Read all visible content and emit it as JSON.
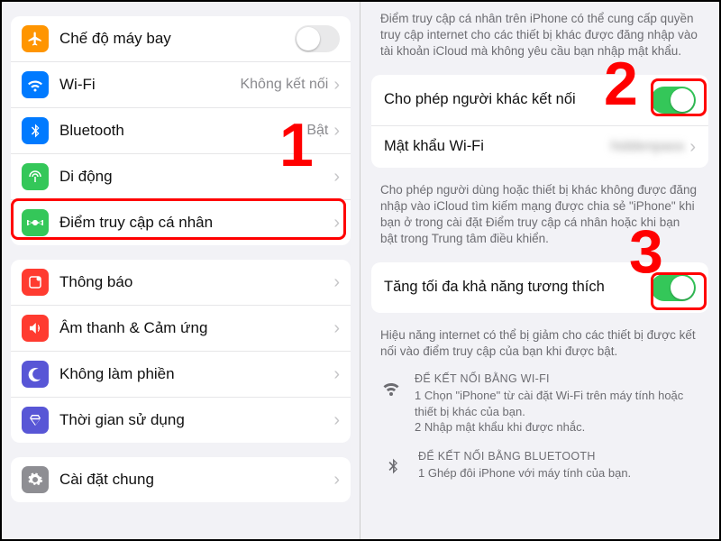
{
  "left": {
    "airplane": "Chế độ máy bay",
    "wifi": "Wi-Fi",
    "wifi_value": "Không kết nối",
    "bluetooth": "Bluetooth",
    "bluetooth_value": "Bật",
    "cellular": "Di động",
    "hotspot": "Điểm truy cập cá nhân",
    "notifications": "Thông báo",
    "sound": "Âm thanh & Cảm ứng",
    "dnd": "Không làm phiền",
    "screentime": "Thời gian sử dụng",
    "general": "Cài đặt chung"
  },
  "right": {
    "intro": "Điểm truy cập cá nhân trên iPhone có thể cung cấp quyền truy cập internet cho các thiết bị khác được đăng nhập vào tài khoản iCloud mà không yêu cầu bạn nhập mật khẩu.",
    "allow_others": "Cho phép người khác kết nối",
    "wifi_password_label": "Mật khẩu Wi-Fi",
    "wifi_password_value": "hiddenpass",
    "allow_note": "Cho phép người dùng hoặc thiết bị khác không được đăng nhập vào iCloud tìm kiếm mạng được chia sẻ \"iPhone\" khi bạn ở trong cài đặt Điểm truy cập cá nhân hoặc khi bạn bật trong Trung tâm điều khiển.",
    "compat": "Tăng tối đa khả năng tương thích",
    "compat_note": "Hiệu năng internet có thể bị giảm cho các thiết bị được kết nối vào điểm truy cập của bạn khi được bật.",
    "wifi_hd": "ĐỂ KẾT NỐI BẰNG WI-FI",
    "wifi_l1": "1 Chọn \"iPhone\" từ cài đặt Wi-Fi trên máy tính hoặc thiết bị khác của bạn.",
    "wifi_l2": "2 Nhập mật khẩu khi được nhắc.",
    "bt_hd": "ĐỂ KẾT NỐI BẰNG BLUETOOTH",
    "bt_l1": "1 Ghép đôi iPhone với máy tính của bạn."
  },
  "annotations": {
    "n1": "1",
    "n2": "2",
    "n3": "3"
  }
}
